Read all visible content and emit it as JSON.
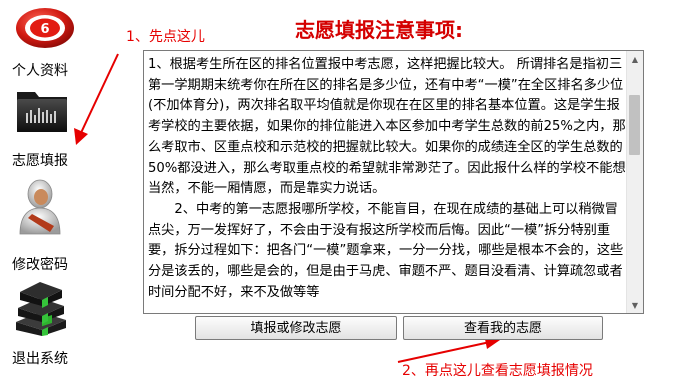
{
  "title": "志愿填报注意事项:",
  "sidebar": {
    "items": [
      {
        "label": "个人资料",
        "icon": "logo-ring-icon"
      },
      {
        "label": "志愿填报",
        "icon": "folder-icon"
      },
      {
        "label": "修改密码",
        "icon": "user-icon"
      },
      {
        "label": "退出系统",
        "icon": "books-icon"
      }
    ]
  },
  "annotations": {
    "step1": "1、先点这儿",
    "step2": "2、再点这儿查看志愿填报情况"
  },
  "notes": {
    "paragraphs": [
      "1、根据考生所在区的排名位置报中考志愿，这样把握比较大。 所谓排名是指初三第一学期期末统考你在所在区的排名是多少位，还有中考“一模”在全区排名多少位(不加体育分)，两次排名取平均值就是你现在在区里的排名基本位置。这是学生报考学校的主要依据，如果你的排位能进入本区参加中考学生总数的前25%之内，那么考取市、区重点校和示范校的把握就比较大。如果你的成绩连全区的学生总数的50%都没进入，那么考取重点校的希望就非常渺茫了。因此报什么样的学校不能想当然，不能一厢情愿，而是靠实力说话。",
      "　　2、中考的第一志愿报哪所学校，不能盲目，在现在成绩的基础上可以稍微冒点尖，万一发挥好了，不会由于没有报这所学校而后悔。因此“一模”拆分特别重要，拆分过程如下：把各门“一模”题拿来，一分一分找，哪些是根本不会的，这些分是该丢的，哪些是会的，但是由于马虎、审题不严、题目没看清、计算疏忽或者时间分配不好，来不及做等等"
    ]
  },
  "buttons": {
    "fill": "填报或修改志愿",
    "view": "查看我的志愿"
  },
  "colors": {
    "title": "#d40000",
    "annotation": "#e60000",
    "arrow": "#e60000"
  }
}
